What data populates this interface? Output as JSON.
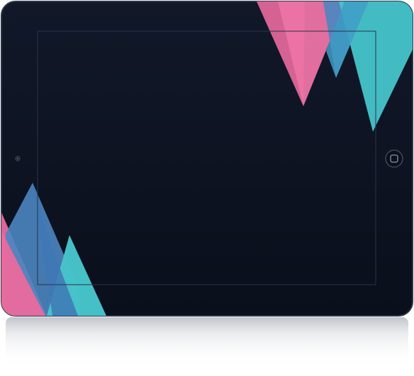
{
  "device": {
    "type": "tablet",
    "orientation": "landscape",
    "body_color": "#0d1321",
    "bezel_edge_color": "#1b2336",
    "screen_outline_color": "#2a3346",
    "screen_state": "blank",
    "reflection": true
  },
  "decoration": {
    "style": "geometric-triangles",
    "colors": {
      "pink": "#ea6a9e",
      "blue": "#4a86c0",
      "teal": "#47c4cb"
    },
    "placement": [
      "top-right",
      "bottom-left"
    ]
  },
  "controls": {
    "home_button_icon": "home-button-icon",
    "camera_icon": "camera-icon"
  }
}
